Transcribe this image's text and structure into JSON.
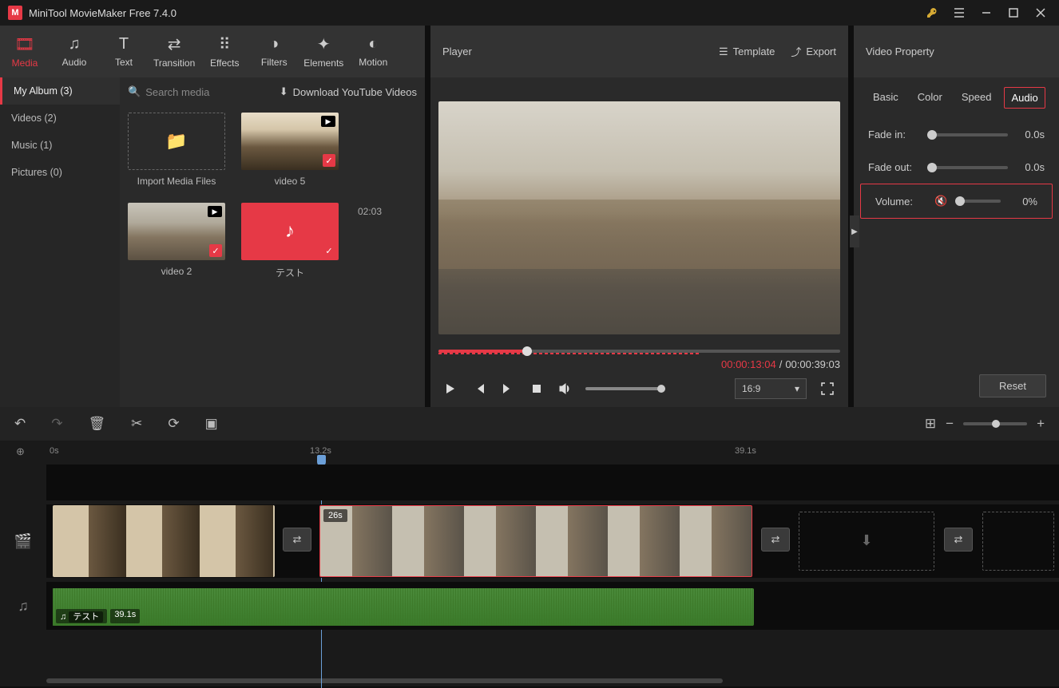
{
  "app": {
    "title": "MiniTool MovieMaker Free 7.4.0"
  },
  "toolbar": [
    {
      "label": "Media",
      "active": true
    },
    {
      "label": "Audio"
    },
    {
      "label": "Text"
    },
    {
      "label": "Transition"
    },
    {
      "label": "Effects"
    },
    {
      "label": "Filters"
    },
    {
      "label": "Elements"
    },
    {
      "label": "Motion"
    }
  ],
  "sidebar": [
    {
      "label": "My Album (3)",
      "active": true
    },
    {
      "label": "Videos (2)"
    },
    {
      "label": "Music (1)"
    },
    {
      "label": "Pictures (0)"
    }
  ],
  "search_placeholder": "Search media",
  "download_yt": "Download YouTube Videos",
  "thumbs": {
    "import": "Import Media Files",
    "v5": "video 5",
    "v2": "video 2",
    "test": "テスト",
    "test_dur": "02:03"
  },
  "player": {
    "title": "Player",
    "template": "Template",
    "export": "Export",
    "cur": "00:00:13:04",
    "tot": "00:00:39:03",
    "aspect": "16:9"
  },
  "prop": {
    "title": "Video Property",
    "tabs": [
      "Basic",
      "Color",
      "Speed",
      "Audio"
    ],
    "fadein_label": "Fade in:",
    "fadein_val": "0.0s",
    "fadeout_label": "Fade out:",
    "fadeout_val": "0.0s",
    "volume_label": "Volume:",
    "volume_val": "0%",
    "reset": "Reset"
  },
  "ruler": {
    "t0": "0s",
    "t1": "13.2s",
    "t2": "39.1s"
  },
  "timeline": {
    "clip2_dur": "26s",
    "audio_name": "テスト",
    "audio_dur": "39.1s"
  }
}
